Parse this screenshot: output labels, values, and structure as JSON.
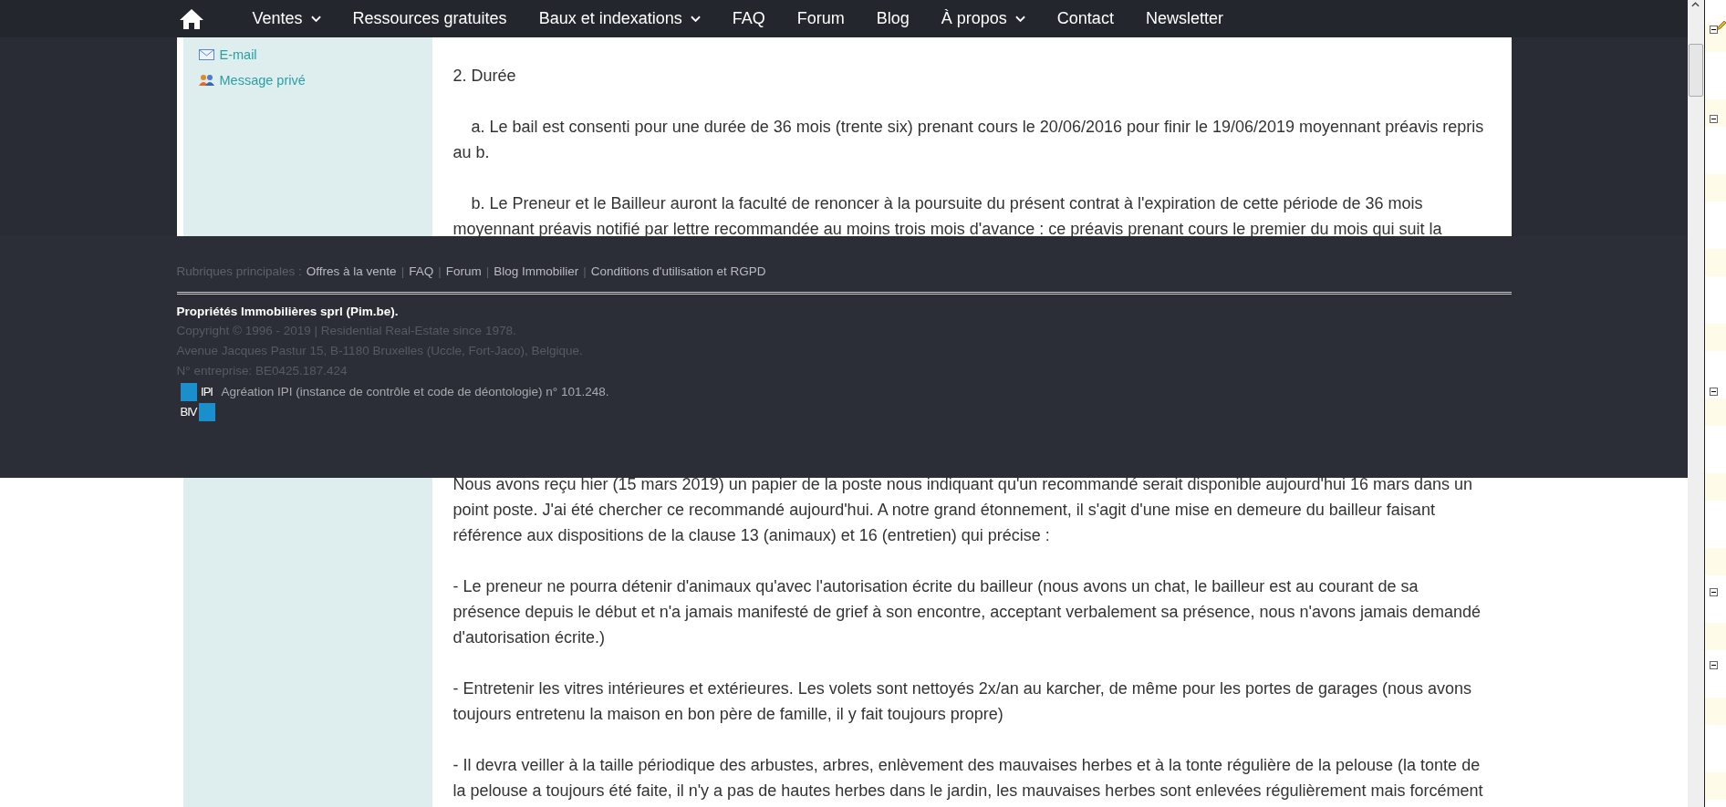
{
  "nav": {
    "items": [
      {
        "label": "Ventes",
        "dropdown": true
      },
      {
        "label": "Ressources gratuites",
        "dropdown": false
      },
      {
        "label": "Baux et indexations",
        "dropdown": true
      },
      {
        "label": "FAQ",
        "dropdown": false
      },
      {
        "label": "Forum",
        "dropdown": false
      },
      {
        "label": "Blog",
        "dropdown": false
      },
      {
        "label": "À propos",
        "dropdown": true
      },
      {
        "label": "Contact",
        "dropdown": false
      },
      {
        "label": "Newsletter",
        "dropdown": false
      }
    ]
  },
  "sidebar": {
    "links": [
      {
        "label": "E-mail",
        "kind": "email"
      },
      {
        "label": "Message privé",
        "kind": "message"
      }
    ]
  },
  "post": {
    "sections": [
      {
        "paragraphs": [
          {
            "text": "2. Durée",
            "indent": false
          },
          {
            "text": "a. Le bail est consenti pour une durée de 36 mois (trente six) prenant cours le 20/06/2016 pour finir le 19/06/2019 moyennant préavis repris au b.",
            "indent": true
          },
          {
            "text": "b. Le Preneur et le Bailleur auront la faculté de renoncer à la poursuite du présent contrat à l'expiration de cette période de 36 mois moyennant préavis notifié par lettre recommandée au moins trois mois d'avance : ce préavis prenant cours le premier du mois qui suit la",
            "indent": true
          }
        ]
      },
      {
        "paragraphs": [
          {
            "text": "Nous avons reçu hier (15 mars 2019) un papier de la poste nous indiquant qu'un recommandé serait disponible aujourd'hui 16 mars dans un point poste. J'ai été chercher ce recommandé aujourd'hui. A notre grand étonnement, il s'agit d'une mise en demeure du bailleur faisant référence aux dispositions de la clause 13 (animaux) et 16 (entretien) qui précise :",
            "indent": false
          },
          {
            "text": "- Le preneur ne pourra détenir d'animaux qu'avec l'autorisation écrite du bailleur (nous avons un chat, le bailleur est au courant de sa présence depuis le début et n'a jamais manifesté de grief à son encontre, acceptant verbalement sa présence, nous n'avons jamais demandé d'autorisation écrite.)",
            "indent": false
          },
          {
            "text": "- Entretenir les vitres intérieures et extérieures. Les volets sont nettoyés 2x/an au karcher, de même pour les portes de garages (nous avons toujours entretenu la maison en bon père de famille, il y fait toujours propre)",
            "indent": false
          },
          {
            "text": "- Il devra veiller à la taille périodique des arbustes, arbres, enlèvement des mauvaises herbes et à la tonte régulière de la pelouse (la tonte de la pelouse a toujours été faite, il n'y a pas de hautes herbes dans le jardin, les mauvaises herbes sont enlevées régulièrement mais forcément",
            "indent": false
          }
        ]
      }
    ]
  },
  "footer": {
    "rubriques_label": "Rubriques principales :",
    "separator": "|",
    "links": [
      "Offres à la vente",
      "FAQ",
      "Forum",
      "Blog Immobilier",
      "Conditions d'utilisation et RGPD"
    ],
    "company": "Propriétés Immobilières sprl (Pim.be).",
    "lines": [
      "Copyright © 1996 - 2019 | Residential Real-Estate since 1978.",
      "Avenue Jacques Pastur 15, B-1180 Bruxelles (Uccle, Fort-Jaco), Belgique.",
      "N° entreprise: BE0425.187.424"
    ],
    "logo": {
      "top_text": "IPI",
      "bottom_text": "BIV"
    },
    "agreement": "Agréation IPI (instance de contrôle et code de déontologie) n° 101.248."
  }
}
